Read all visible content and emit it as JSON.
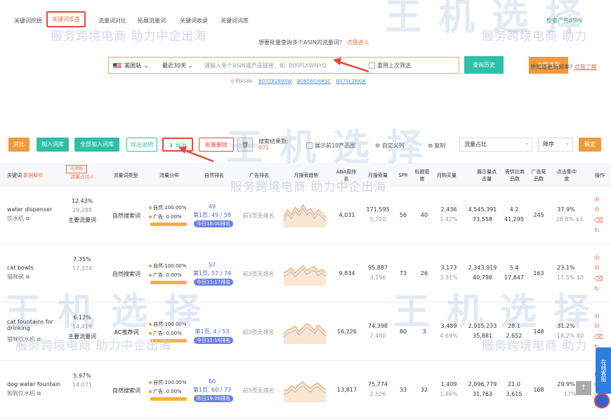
{
  "nav": {
    "tabs": [
      "关键词挖掘",
      "关键词反查",
      "流量词对比",
      "拓展流量词",
      "关键词收录",
      "关键词词库"
    ],
    "active_tab": "关键词反查",
    "ad_link": "反查广告ASIN"
  },
  "watermark": {
    "text": "服务跨境电商 助力中企出海",
    "partial": "服务跨境电商 助力",
    "logo": "王 机 选 择"
  },
  "prompt": {
    "text": "想要批量查询多个ASIN的流量词？",
    "link": "点我进入"
  },
  "search": {
    "site": "美国站",
    "period": "最近30天",
    "placeholder": "请输入单个ASIN或产品链接，如: B00FLYWNYQ",
    "checkbox_label": "重用上次筛选",
    "query_button": "立即查询",
    "history_button": "查询历史",
    "tip_text": "想知道更新频率?",
    "tip_link": "点我了解",
    "examples_label": "示例ASIN:",
    "examples": [
      "B07Z82895W",
      "B0856CHMSC",
      "B07SL2RKJK"
    ]
  },
  "toolbar": {
    "compare": "对比",
    "add_lib": "加入词库",
    "add_all": "全部加入词库",
    "export_desc": "导出说明",
    "export": "导出",
    "batch_delete": "批量删除",
    "search_count_label": "搜索结果数:",
    "search_count": "971",
    "show_top10": "展示前10产品图",
    "custom_columns": "自定义列",
    "copy": "复制",
    "sort_field": "流量占比",
    "sort_order": "降序",
    "confirm": "确定"
  },
  "table": {
    "headers": {
      "keyword": "关键词",
      "keyword_tag": "数据解析",
      "traffic_share": "流量占比↓",
      "share_tag": "内测版",
      "word_type": "流量词类型",
      "distribution": "流量分布",
      "natural_rank": "自然排名",
      "ad_rank": "广告排名",
      "trend": "月搜索趋势",
      "aba": "ABA周排名",
      "monthly_search": "月搜索量",
      "spr": "SPR",
      "title_density": "标题密度",
      "monthly_purchase": "月购买量",
      "impressions": "展示量点击量",
      "supply_demand": "需供比商品数",
      "ad_count": "广告竞品数",
      "click_concentration": "点击集中度",
      "actions": "操作"
    },
    "rows": [
      {
        "kw": "water dispenser",
        "kw_cn": "饮水机",
        "share": "12.43%",
        "share_val": "29,289",
        "share_tag": "主要流量词",
        "type": "自然搜索词",
        "natural": "自然:100.00%",
        "ad": "广告:   0.00%",
        "rank_a": "49",
        "rank_b": "第1页, 49 / 58",
        "rank_badge": "今日16:00排名",
        "ad_rank": "前3页无排名",
        "aba": "4,031",
        "ms1": "171,595",
        "ms2": "5,720",
        "spr": "56",
        "td": "40",
        "mp1": "2,436",
        "mp2": "1.42%",
        "imp1": "4,545,391",
        "imp2": "73,558",
        "sd1": "4.2",
        "sd2": "41,295",
        "adc": "245",
        "cc1": "37.9%",
        "cc2": "28.8%  $3."
      },
      {
        "kw": "cat bowls",
        "kw_cn": "猫咪碗",
        "share": "7.35%",
        "share_val": "17,324",
        "share_tag": "",
        "type": "自然搜索词",
        "natural": "自然:100.00%",
        "ad": "广告:   0.00%",
        "rank_a": "57",
        "rank_b": "第1页, 57 / 74",
        "rank_badge": "今日11:17排名",
        "ad_rank": "前3页无排名",
        "aba": "9,834",
        "ms1": "95,887",
        "ms2": "3,196",
        "spr": "73",
        "td": "26",
        "mp1": "3,173",
        "mp2": "3.31%",
        "imp1": "2,343,919",
        "imp2": "40,798",
        "sd1": "5.4",
        "sd2": "17,847",
        "adc": "163",
        "cc1": "23.1%",
        "cc2": "17.5%  $0"
      },
      {
        "kw": "cat fountains for drinking",
        "kw_cn": "猫咪饮水机",
        "share": "6.12%",
        "share_val": "14,419",
        "share_tag": "主要流量词",
        "type": "AC推荐词",
        "natural": "自然:100.00%",
        "ad": "广告:   0.00%",
        "rank_a": "",
        "rank_b": "第1页, 4 / 53",
        "rank_badge": "今日11:16排名",
        "ad_rank": "前3页无排名",
        "aba": "16,226",
        "ms1": "74,398",
        "ms2": "2,480",
        "spr": "80",
        "td": "3",
        "mp1": "3,489",
        "mp2": "4.69%",
        "imp1": "2,015,233",
        "imp2": "35,881",
        "sd1": "28.1",
        "sd2": "2,652",
        "adc": "148",
        "cc1": "31.2%",
        "cc2": "18.2%  $0"
      },
      {
        "kw": "dog water fountain",
        "kw_cn": "狗狗饮水机",
        "share": "5.97%",
        "share_val": "14,071",
        "share_tag": "",
        "type": "自然搜索词",
        "natural": "自然:100.00%",
        "ad": "广告:   0.00%",
        "rank_a": "60",
        "rank_b": "第1页, 60 / 73",
        "rank_badge": "昨日19:06排名",
        "ad_rank": "前3页无排名",
        "aba": "13,817",
        "ms1": "75,774",
        "ms2": "2,526",
        "spr": "33",
        "td": "32",
        "mp1": "1,409",
        "mp2": "1.86%",
        "imp1": "2,096,779",
        "imp2": "31,763",
        "sd1": "21.0",
        "sd2": "3,615",
        "adc": "168",
        "cc1": "29.9%",
        "cc2": "17%"
      }
    ]
  },
  "side": {
    "chat": "在线客服",
    "top": "↑"
  }
}
